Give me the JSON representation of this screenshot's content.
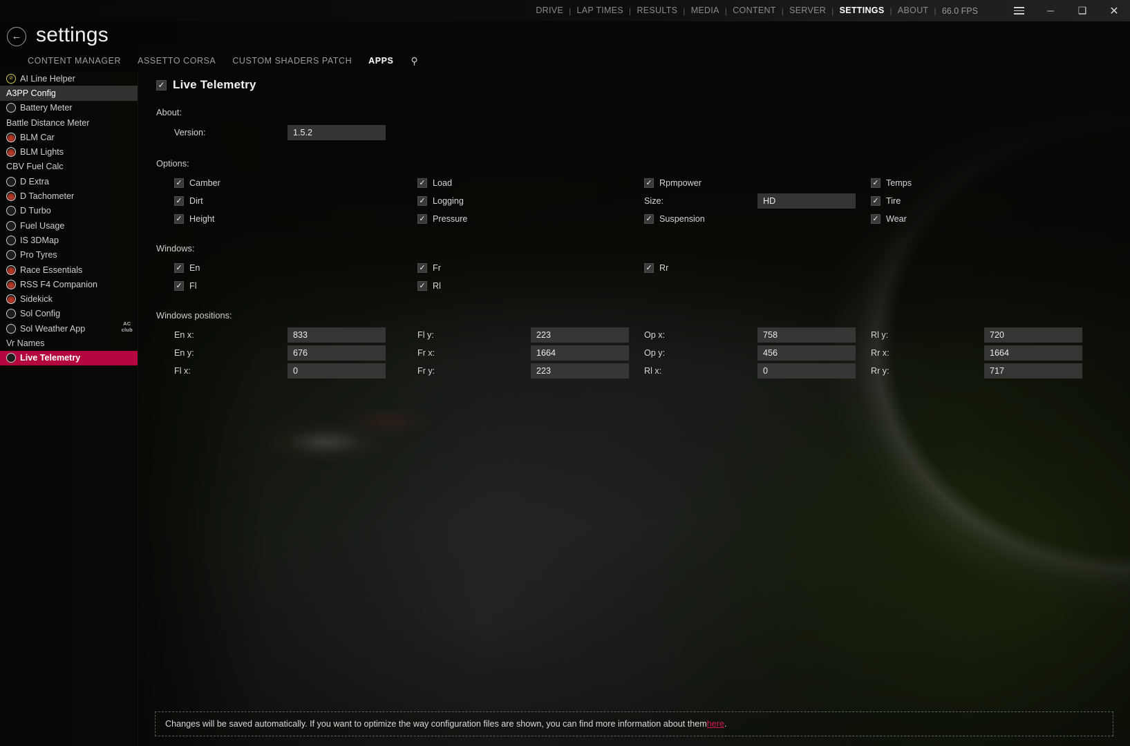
{
  "titlebar": {
    "nav": [
      {
        "label": "DRIVE",
        "active": false
      },
      {
        "label": "LAP TIMES",
        "active": false
      },
      {
        "label": "RESULTS",
        "active": false
      },
      {
        "label": "MEDIA",
        "active": false
      },
      {
        "label": "CONTENT",
        "active": false
      },
      {
        "label": "SERVER",
        "active": false
      },
      {
        "label": "SETTINGS",
        "active": true
      },
      {
        "label": "ABOUT",
        "active": false
      }
    ],
    "fps": "66.0 FPS",
    "menu_icon": "hamburger-icon",
    "minimize_label": "─",
    "maximize_label": "❑",
    "close_label": "✕"
  },
  "header": {
    "back_label": "←",
    "title": "settings",
    "tabs": [
      {
        "label": "CONTENT MANAGER",
        "active": false
      },
      {
        "label": "ASSETTO CORSA",
        "active": false
      },
      {
        "label": "CUSTOM SHADERS PATCH",
        "active": false
      },
      {
        "label": "APPS",
        "active": true
      }
    ],
    "search_icon": "⚲"
  },
  "sidebar": {
    "badge": {
      "line1": "AC",
      "line2": "club"
    },
    "items": [
      {
        "label": "AI Line Helper",
        "icon": "amber",
        "state": "normal"
      },
      {
        "label": "A3PP Config",
        "icon": "none",
        "state": "hover"
      },
      {
        "label": "Battery Meter",
        "icon": "dark",
        "state": "normal"
      },
      {
        "label": "Battle Distance Meter",
        "icon": "none",
        "state": "normal"
      },
      {
        "label": "BLM Car",
        "icon": "red",
        "state": "normal"
      },
      {
        "label": "BLM Lights",
        "icon": "red",
        "state": "normal"
      },
      {
        "label": "CBV Fuel Calc",
        "icon": "none",
        "state": "normal"
      },
      {
        "label": "D Extra",
        "icon": "dark",
        "state": "normal"
      },
      {
        "label": "D Tachometer",
        "icon": "red",
        "state": "normal"
      },
      {
        "label": "D Turbo",
        "icon": "dark",
        "state": "normal"
      },
      {
        "label": "Fuel Usage",
        "icon": "dark",
        "state": "normal"
      },
      {
        "label": "IS 3DMap",
        "icon": "dark",
        "state": "normal"
      },
      {
        "label": "Pro Tyres",
        "icon": "dark",
        "state": "normal"
      },
      {
        "label": "Race Essentials",
        "icon": "red",
        "state": "normal"
      },
      {
        "label": "RSS F4 Companion",
        "icon": "red",
        "state": "normal"
      },
      {
        "label": "Sidekick",
        "icon": "red",
        "state": "normal"
      },
      {
        "label": "Sol Config",
        "icon": "dark",
        "state": "normal"
      },
      {
        "label": "Sol Weather App",
        "icon": "dark",
        "state": "normal"
      },
      {
        "label": "Vr Names",
        "icon": "none",
        "state": "normal"
      },
      {
        "label": "Live Telemetry",
        "icon": "dark",
        "state": "selected"
      }
    ]
  },
  "main": {
    "panel": {
      "title": "Live Telemetry",
      "enabled": true,
      "check_glyph": "✓"
    },
    "about": {
      "heading": "About:",
      "version_label": "Version:",
      "version_value": "1.5.2"
    },
    "options": {
      "heading": "Options:",
      "col1": [
        {
          "label": "Camber",
          "checked": true
        },
        {
          "label": "Dirt",
          "checked": true
        },
        {
          "label": "Height",
          "checked": true
        }
      ],
      "col2": [
        {
          "label": "Load",
          "checked": true
        },
        {
          "label": "Logging",
          "checked": true
        },
        {
          "label": "Pressure",
          "checked": true
        }
      ],
      "col3": [
        {
          "label": "Rpmpower",
          "checked": true
        },
        {
          "label": "Suspension",
          "checked": true
        }
      ],
      "size_label": "Size:",
      "size_value": "HD",
      "col4": [
        {
          "label": "Temps",
          "checked": true
        },
        {
          "label": "Tire",
          "checked": true
        },
        {
          "label": "Wear",
          "checked": true
        }
      ]
    },
    "windows": {
      "heading": "Windows:",
      "col1": [
        {
          "label": "En",
          "checked": true
        },
        {
          "label": "Fl",
          "checked": true
        }
      ],
      "col2": [
        {
          "label": "Fr",
          "checked": true
        },
        {
          "label": "Rl",
          "checked": true
        }
      ],
      "col3": [
        {
          "label": "Rr",
          "checked": true
        }
      ]
    },
    "positions": {
      "heading": "Windows positions:",
      "col1": [
        {
          "label": "En x:",
          "value": "833"
        },
        {
          "label": "En y:",
          "value": "676"
        },
        {
          "label": "Fl x:",
          "value": "0"
        }
      ],
      "col2": [
        {
          "label": "Fl y:",
          "value": "223"
        },
        {
          "label": "Fr x:",
          "value": "1664"
        },
        {
          "label": "Fr y:",
          "value": "223"
        }
      ],
      "col3": [
        {
          "label": "Op x:",
          "value": "758"
        },
        {
          "label": "Op y:",
          "value": "456"
        },
        {
          "label": "Rl x:",
          "value": "0"
        }
      ],
      "col4": [
        {
          "label": "Rl y:",
          "value": "720"
        },
        {
          "label": "Rr x:",
          "value": "1664"
        },
        {
          "label": "Rr y:",
          "value": "717"
        }
      ]
    }
  },
  "notice": {
    "text_before": "Changes will be saved automatically. If you want to optimize the way configuration files are shown, you can find more information about them ",
    "link": "here",
    "text_after": "."
  },
  "colors": {
    "accent": "#b4063f",
    "link": "#d41b4e",
    "input_bg": "#3a3a3a",
    "text": "#d7d7d7"
  }
}
